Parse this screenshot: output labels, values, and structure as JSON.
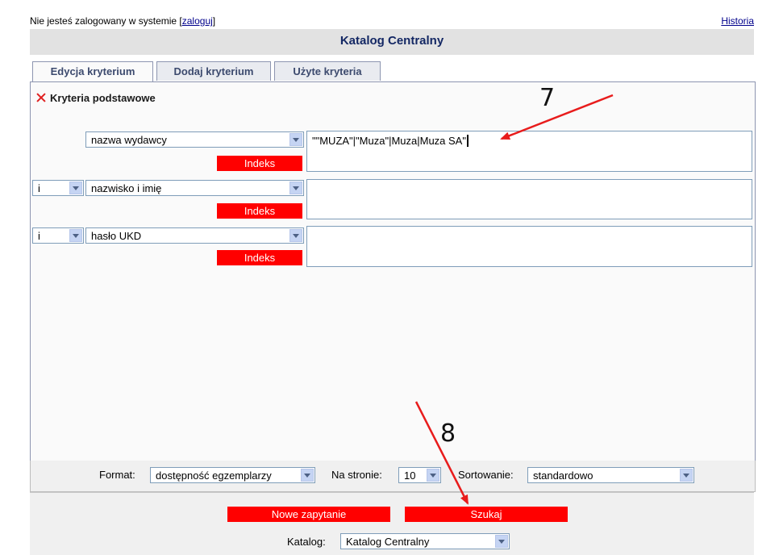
{
  "topbar": {
    "login_prefix": "Nie jesteś zalogowany w systemie [",
    "login_link": "zaloguj",
    "login_suffix": "]",
    "history_link": "Historia"
  },
  "header": {
    "title": "Katalog Centralny"
  },
  "tabs": [
    {
      "label": "Edycja kryterium"
    },
    {
      "label": "Dodaj kryterium"
    },
    {
      "label": "Użyte kryteria"
    }
  ],
  "criteria": {
    "section_title": "Kryteria podstawowe",
    "rows": [
      {
        "operator": "",
        "field": "nazwa wydawcy",
        "index_label": "Indeks",
        "value": "\"\"MUZA\"|\"Muza\"|Muza|Muza SA\""
      },
      {
        "operator": "i",
        "field": "nazwisko i imię",
        "index_label": "Indeks",
        "value": ""
      },
      {
        "operator": "i",
        "field": "hasło UKD",
        "index_label": "Indeks",
        "value": ""
      }
    ]
  },
  "options": {
    "format_label": "Format:",
    "format_value": "dostępność egzemplarzy",
    "per_page_label": "Na stronie:",
    "per_page_value": "10",
    "sort_label": "Sortowanie:",
    "sort_value": "standardowo"
  },
  "actions": {
    "new_query": "Nowe zapytanie",
    "search": "Szukaj",
    "catalog_label": "Katalog:",
    "catalog_value": "Katalog Centralny"
  },
  "annotations": {
    "step7": "7",
    "step8": "8"
  },
  "colors": {
    "accent_red": "#ff0000",
    "header_bg": "#e2e2e2",
    "title_color": "#142864"
  }
}
